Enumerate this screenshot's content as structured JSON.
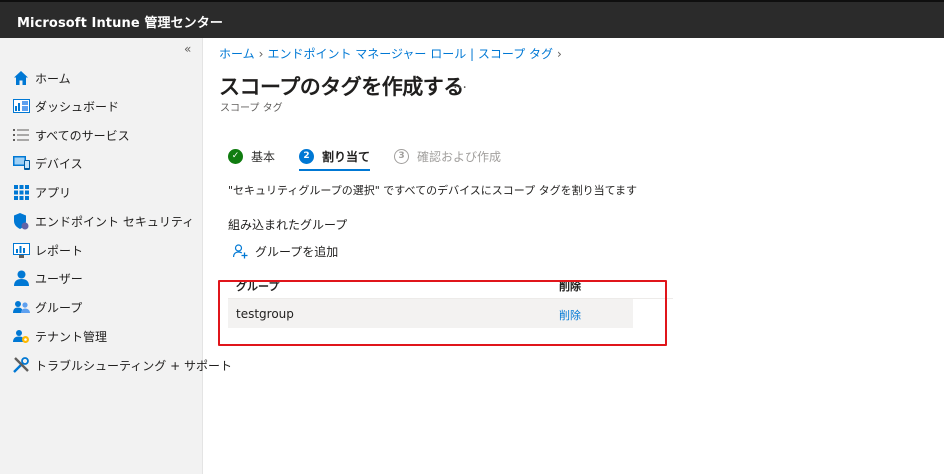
{
  "topbar": {
    "title": "Microsoft Intune 管理センター"
  },
  "sidebar": {
    "collapse_glyph": "«",
    "items": [
      {
        "label": "ホーム",
        "icon": "home-icon"
      },
      {
        "label": "ダッシュボード",
        "icon": "dashboard-icon"
      },
      {
        "label": "すべてのサービス",
        "icon": "list-icon"
      },
      {
        "label": "デバイス",
        "icon": "devices-icon"
      },
      {
        "label": "アプリ",
        "icon": "apps-icon"
      },
      {
        "label": "エンドポイント セキュリティ",
        "icon": "endpoint-security-icon"
      },
      {
        "label": "レポート",
        "icon": "reports-icon"
      },
      {
        "label": "ユーザー",
        "icon": "user-icon"
      },
      {
        "label": "グループ",
        "icon": "groups-icon"
      },
      {
        "label": "テナント管理",
        "icon": "tenant-admin-icon"
      },
      {
        "label": "トラブルシューティング + サポート",
        "icon": "troubleshooting-icon"
      }
    ]
  },
  "breadcrumb": [
    "ホーム",
    "エンドポイント マネージャー ロール | スコープ タグ"
  ],
  "page": {
    "title": "スコープのタグを作成する",
    "more": "…",
    "subtitle": "スコープ タグ"
  },
  "steps": [
    {
      "label": "基本",
      "state": "done",
      "marker": "✓"
    },
    {
      "label": "割り当て",
      "state": "active",
      "marker": "2"
    },
    {
      "label": "確認および作成",
      "state": "pending",
      "marker": "3"
    }
  ],
  "assignment": {
    "description": "\"セキュリティグループの選択\" ですべてのデバイスにスコープ タグを割り当てます",
    "section_title": "組み込まれたグループ",
    "add_group_label": "グループを追加"
  },
  "table": {
    "headers": [
      "グループ",
      "削除"
    ],
    "rows": [
      {
        "group": "testgroup",
        "action": "削除"
      }
    ]
  },
  "colors": {
    "accent": "#0078d4",
    "success": "#107c10",
    "highlight": "#e0151b",
    "topbar": "#2b2b2b"
  }
}
